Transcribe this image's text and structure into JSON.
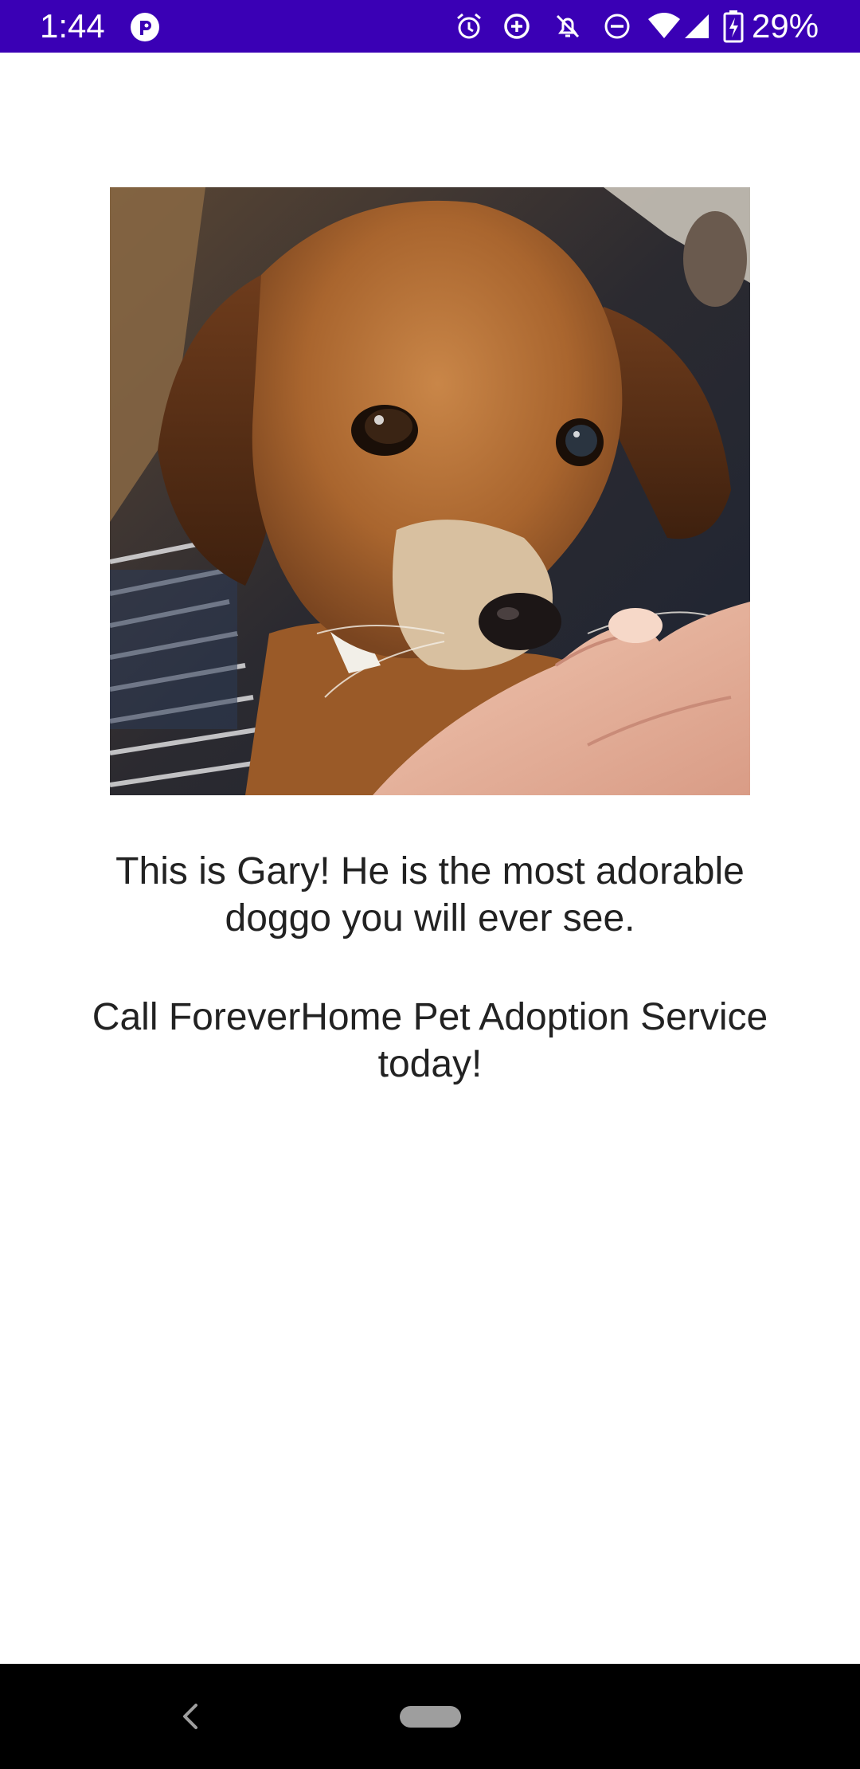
{
  "status_bar": {
    "time": "1:44",
    "battery_percent": "29%",
    "background_color": "#3a00b5",
    "icons": [
      "app-notification-icon",
      "alarm-icon",
      "data-saver-icon",
      "notifications-off-icon",
      "do-not-disturb-icon",
      "wifi-icon",
      "cell-signal-icon",
      "battery-charging-icon"
    ]
  },
  "main": {
    "photo": {
      "subject": "brown puppy held in a hand"
    },
    "caption": {
      "line1": "This is Gary! He is the most adorable doggo you will ever see.",
      "line2": "Call ForeverHome Pet Adoption Service today!"
    }
  },
  "nav_bar": {
    "icons": [
      "back-icon",
      "home-pill-icon"
    ]
  }
}
